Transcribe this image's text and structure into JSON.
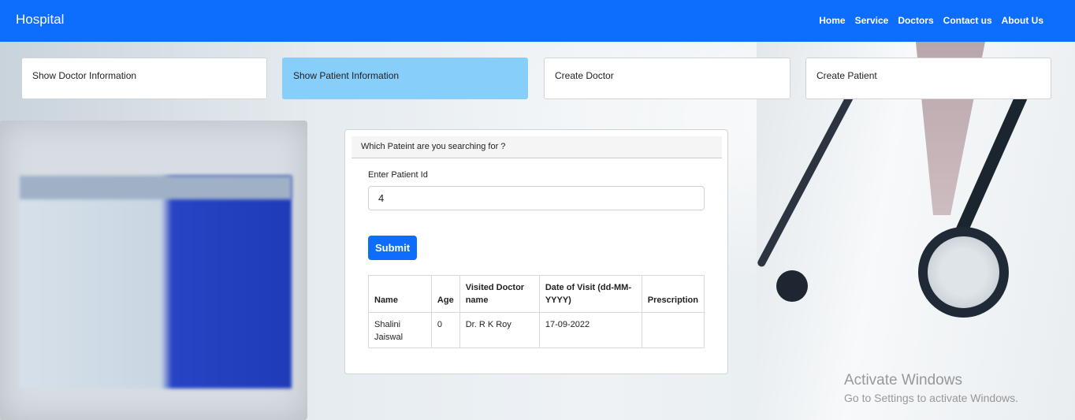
{
  "navbar": {
    "brand": "Hospital",
    "links": [
      "Home",
      "Service",
      "Doctors",
      "Contact us",
      "About Us"
    ]
  },
  "actions": {
    "show_doctor": "Show Doctor Information",
    "show_patient": "Show Patient Information",
    "create_doctor": "Create Doctor",
    "create_patient": "Create Patient",
    "active": "show_patient",
    "active_color": "#87cefa"
  },
  "search": {
    "header": "Which Pateint are you searching for ?",
    "field_label": "Enter Patient Id",
    "patient_id_value": "4",
    "submit_label": "Submit"
  },
  "results": {
    "columns": [
      "Name",
      "Age",
      "Visited Doctor name",
      "Date of Visit (dd-MM-YYYY)",
      "Prescription"
    ],
    "rows": [
      [
        "Shalini Jaiswal",
        "0",
        "Dr. R K Roy",
        "17-09-2022",
        ""
      ]
    ]
  },
  "watermark": {
    "title": "Activate Windows",
    "subtitle": "Go to Settings to activate Windows."
  },
  "colors": {
    "primary": "#0d6efd"
  }
}
